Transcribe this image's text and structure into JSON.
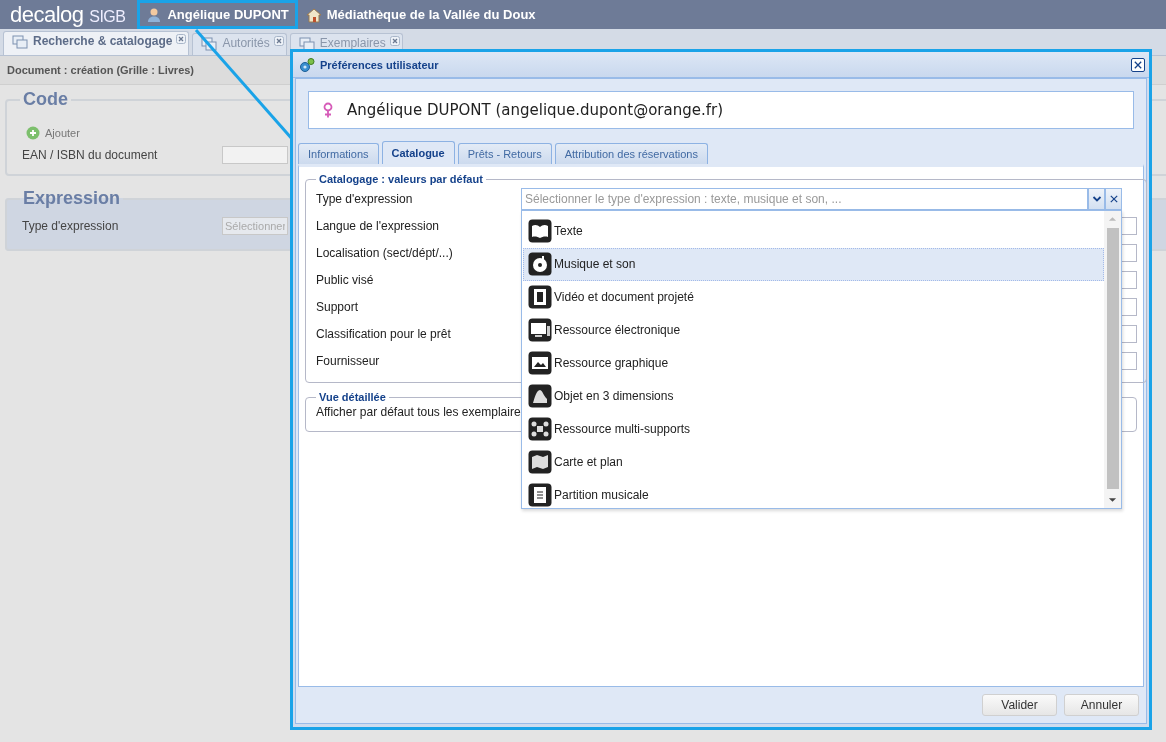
{
  "app_bar": {
    "logo_name": "decalog",
    "logo_suffix": "SIGB",
    "user": "Angélique DUPONT",
    "library": "Médiathèque de la Vallée du Doux"
  },
  "tabs": [
    {
      "label": "Recherche & catalogage",
      "selected": true
    },
    {
      "label": "Autorités",
      "selected": false
    },
    {
      "label": "Exemplaires",
      "selected": false
    }
  ],
  "breadcrumb": "Document : création (Grille : Livres)",
  "code_section": {
    "title": "Code",
    "add_link": "Ajouter",
    "field_label": "EAN / ISBN du document"
  },
  "expression_section": {
    "title": "Expression",
    "field_label": "Type d'expression",
    "placeholder": "Sélectionner"
  },
  "dialog": {
    "title": "Préférences utilisateur",
    "user": "Angélique DUPONT (angelique.dupont@orange.fr)",
    "tabs": [
      {
        "label": "Informations",
        "selected": false
      },
      {
        "label": "Catalogue",
        "selected": true
      },
      {
        "label": "Prêts - Retours",
        "selected": false
      },
      {
        "label": "Attribution des réservations",
        "selected": false
      }
    ],
    "catalog_group": {
      "title": "Catalogage : valeurs par défaut",
      "fields": [
        "Type d'expression",
        "Langue de l'expression",
        "Localisation (sect/dépt/...)",
        "Public visé",
        "Support",
        "Classification pour le prêt",
        "Fournisseur"
      ]
    },
    "combo": {
      "placeholder": "Sélectionner le type d'expression : texte, musique et son, ...",
      "options": [
        {
          "label": "Texte",
          "selected": false
        },
        {
          "label": "Musique et son",
          "selected": true
        },
        {
          "label": "Vidéo et document projeté",
          "selected": false
        },
        {
          "label": "Ressource électronique",
          "selected": false
        },
        {
          "label": "Ressource graphique",
          "selected": false
        },
        {
          "label": "Objet en 3 dimensions",
          "selected": false
        },
        {
          "label": "Ressource multi-supports",
          "selected": false
        },
        {
          "label": "Carte et plan",
          "selected": false
        },
        {
          "label": "Partition musicale",
          "selected": false
        }
      ]
    },
    "detail_group": {
      "title": "Vue détaillée",
      "text": "Afficher par défaut tous les exemplaire"
    },
    "buttons": [
      "Valider",
      "Annuler"
    ]
  }
}
